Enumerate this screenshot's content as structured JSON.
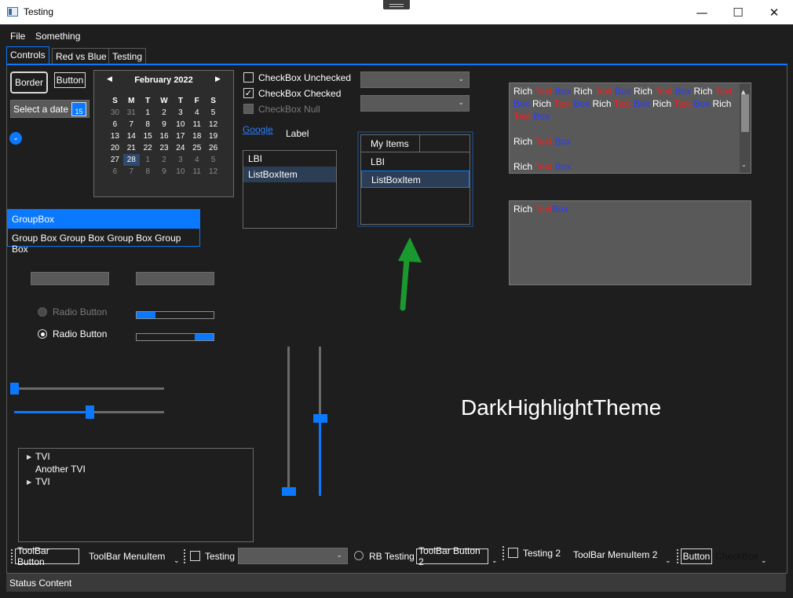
{
  "window": {
    "title": "Testing",
    "minimize": "—",
    "maximize": "☐",
    "close": "✕"
  },
  "menu": [
    "File",
    "Something"
  ],
  "tabs": [
    "Controls",
    "Red vs Blue",
    "Testing"
  ],
  "controls": {
    "border_label": "Border",
    "button_label": "Button",
    "datepicker_placeholder": "Select a date",
    "datepicker_icon_day": "15",
    "calendar": {
      "month": "February 2022",
      "day_names": [
        "S",
        "M",
        "T",
        "W",
        "T",
        "F",
        "S"
      ],
      "weeks": [
        [
          "30",
          "31",
          "1",
          "2",
          "3",
          "4",
          "5"
        ],
        [
          "6",
          "7",
          "8",
          "9",
          "10",
          "11",
          "12"
        ],
        [
          "13",
          "14",
          "15",
          "16",
          "17",
          "18",
          "19"
        ],
        [
          "20",
          "21",
          "22",
          "23",
          "24",
          "25",
          "26"
        ],
        [
          "27",
          "28",
          "1",
          "2",
          "3",
          "4",
          "5"
        ],
        [
          "6",
          "7",
          "8",
          "9",
          "10",
          "11",
          "12"
        ]
      ],
      "selected_day": "28"
    },
    "checkbox_unchecked": "CheckBox Unchecked",
    "checkbox_checked": "CheckBox Checked",
    "checkbox_null": "CheckBox Null",
    "link": "Google",
    "label": "Label",
    "listbox1": [
      "LBI",
      "ListBoxItem"
    ],
    "listbox2_header": "My Items",
    "listbox2": [
      "LBI",
      "ListBoxItem"
    ],
    "groupbox_header": "GroupBox",
    "groupbox_content": "Group Box Group Box Group Box Group Box",
    "radio1": "Radio Button",
    "radio2": "Radio Button",
    "progress1": 0.24,
    "progress2": 0.24,
    "slider1": 0.0,
    "slider2": 0.5,
    "vslider1": 0.0,
    "vslider2": 0.52,
    "tree": [
      "TVI",
      "Another TVI",
      "TVI"
    ],
    "rich_text_main": [
      "Rich",
      "Text",
      "Box"
    ],
    "rich_text_second": [
      "Rich",
      "Text",
      "Box"
    ],
    "theme_label": "DarkHighlightTheme"
  },
  "toolbar": {
    "button1": "ToolBar Button",
    "menuitem1": "ToolBar MenuItem",
    "checkbox1": "Testing",
    "radio": "RB Testing",
    "button2": "ToolBar Button 2",
    "checkbox2": "Testing 2",
    "menuitem2": "ToolBar MenuItem 2",
    "button3": "Button",
    "checkbox3": "CheckBox"
  },
  "status": "Status Content",
  "colors": {
    "accent": "#0a78ff",
    "background": "#1e1e1e",
    "annotation_arrow": "#1a9a2e"
  }
}
